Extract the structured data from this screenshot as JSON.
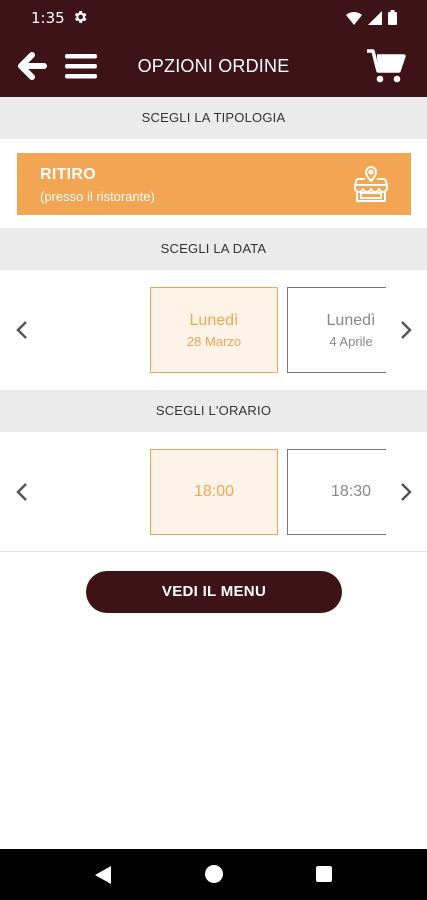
{
  "status_bar": {
    "time": "1:35"
  },
  "app_bar": {
    "title": "OPZIONI ORDINE"
  },
  "sections": {
    "tipologia": "SCEGLI LA TIPOLOGIA",
    "data": "SCEGLI LA DATA",
    "orario": "SCEGLI L'ORARIO"
  },
  "order_type": {
    "title": "RITIRO",
    "subtitle": "(presso il ristorante)"
  },
  "dates": [
    {
      "day": "Lunedì",
      "date": "28 Marzo",
      "selected": true
    },
    {
      "day": "Lunedì",
      "date": "4 Aprile",
      "selected": false
    }
  ],
  "times": [
    {
      "time": "18:00",
      "selected": true
    },
    {
      "time": "18:30",
      "selected": false
    }
  ],
  "menu_button": {
    "label": "VEDI IL MENU"
  },
  "colors": {
    "brand": "#3d1318",
    "accent": "#f2a552",
    "section_bg": "#ebebeb"
  }
}
